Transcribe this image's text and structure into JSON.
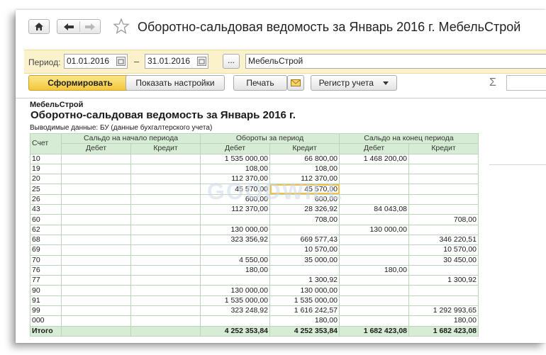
{
  "window": {
    "title": "Оборотно-сальдовая ведомость за Январь 2016 г. МебельСтрой"
  },
  "period_bar": {
    "label": "Период:",
    "date_from": "01.01.2016",
    "separator": "–",
    "date_to": "31.01.2016",
    "select_button": "...",
    "organization": "МебельСтрой"
  },
  "toolbar": {
    "generate": "Сформировать",
    "show_settings": "Показать настройки",
    "print": "Печать",
    "register": "Регистр учета",
    "sigma": "Σ"
  },
  "report": {
    "organization": "МебельСтрой",
    "title": "Оборотно-сальдовая ведомость за Январь 2016 г.",
    "info": "Выводимые данные:  БУ (данные бухгалтерского учета)",
    "watermark": "GOODWILL",
    "header": {
      "account": "Счет",
      "opening": "Сальдо на начало периода",
      "turnover": "Обороты за период",
      "closing": "Сальдо на конец периода",
      "debit": "Дебет",
      "credit": "Кредит"
    },
    "rows": [
      [
        "10",
        "",
        "",
        "1 535 000,00",
        "66 800,00",
        "1 468 200,00",
        ""
      ],
      [
        "19",
        "",
        "",
        "108,00",
        "108,00",
        "",
        ""
      ],
      [
        "20",
        "",
        "",
        "112 370,00",
        "112 370,00",
        "",
        ""
      ],
      [
        "25",
        "",
        "",
        "45 570,00",
        "45 570,00",
        "",
        ""
      ],
      [
        "26",
        "",
        "",
        "600,00",
        "600,00",
        "",
        ""
      ],
      [
        "43",
        "",
        "",
        "112 370,00",
        "28 326,92",
        "84 043,08",
        ""
      ],
      [
        "60",
        "",
        "",
        "",
        "708,00",
        "",
        "708,00"
      ],
      [
        "62",
        "",
        "",
        "130 000,00",
        "",
        "130 000,00",
        ""
      ],
      [
        "68",
        "",
        "",
        "323 356,92",
        "669 577,43",
        "",
        "346 220,51"
      ],
      [
        "69",
        "",
        "",
        "",
        "10 570,00",
        "",
        "10 570,00"
      ],
      [
        "70",
        "",
        "",
        "4 550,00",
        "35 000,00",
        "",
        "30 450,00"
      ],
      [
        "76",
        "",
        "",
        "180,00",
        "",
        "180,00",
        ""
      ],
      [
        "77",
        "",
        "",
        "",
        "1 300,92",
        "",
        "1 300,92"
      ],
      [
        "90",
        "",
        "",
        "130 000,00",
        "130 000,00",
        "",
        ""
      ],
      [
        "91",
        "",
        "",
        "1 535 000,00",
        "1 535 000,00",
        "",
        ""
      ],
      [
        "99",
        "",
        "",
        "323 248,92",
        "1 616 242,57",
        "",
        "1 292 993,65"
      ],
      [
        "000",
        "",
        "",
        "",
        "180,00",
        "",
        "180,00"
      ]
    ],
    "total": [
      "Итого",
      "",
      "",
      "4 252 353,84",
      "4 252 353,84",
      "1 682 423,08",
      "1 682 423,08"
    ]
  }
}
